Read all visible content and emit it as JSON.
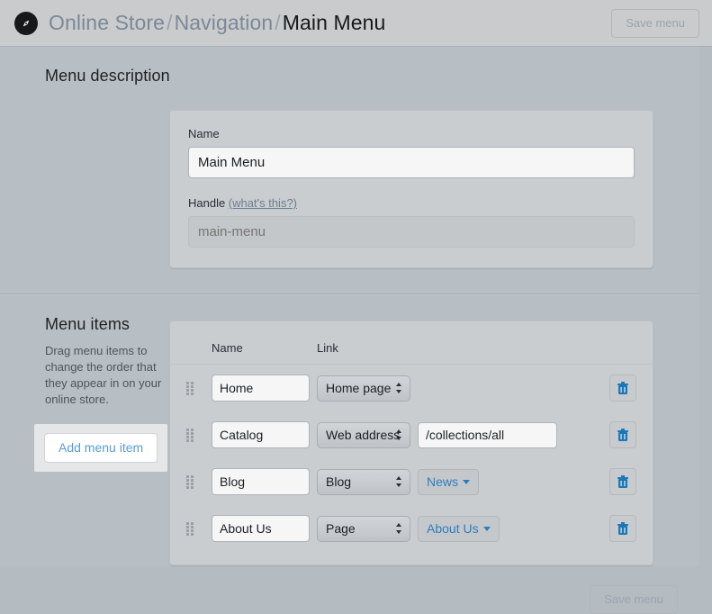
{
  "header": {
    "icon": "compass-icon",
    "breadcrumb": [
      {
        "label": "Online Store",
        "current": false
      },
      {
        "label": "Navigation",
        "current": false
      },
      {
        "label": "Main Menu",
        "current": true
      }
    ],
    "separator": "/",
    "save_label": "Save menu",
    "save_disabled": true
  },
  "description_section": {
    "heading": "Menu description",
    "name_label": "Name",
    "name_value": "Main Menu",
    "handle_label": "Handle",
    "handle_help_link": "(what's this?)",
    "handle_placeholder": "main-menu",
    "handle_value": ""
  },
  "items_section": {
    "heading": "Menu items",
    "help_text": "Drag menu items to change the order that they appear in on your online store.",
    "add_label": "Add menu item",
    "columns": {
      "handle": "",
      "name": "Name",
      "link": "Link"
    },
    "rows": [
      {
        "drag": "drag-handle",
        "name": "Home",
        "link_type": "Home page",
        "url": null,
        "sub": null,
        "delete": "delete-icon"
      },
      {
        "drag": "drag-handle",
        "name": "Catalog",
        "link_type": "Web address",
        "url": "/collections/all",
        "sub": null,
        "delete": "delete-icon"
      },
      {
        "drag": "drag-handle",
        "name": "Blog",
        "link_type": "Blog",
        "url": null,
        "sub": "News",
        "delete": "delete-icon"
      },
      {
        "drag": "drag-handle",
        "name": "About Us",
        "link_type": "Page",
        "url": null,
        "sub": "About Us",
        "delete": "delete-icon"
      }
    ]
  },
  "footer": {
    "save_label": "Save menu",
    "save_disabled": true
  },
  "colors": {
    "page_background": "#b8bfc4",
    "header_background": "#c9cbcd",
    "card_background": "#cacdd0",
    "link_blue": "#2f7cbf",
    "add_button_blue": "#5a9bd8",
    "disabled_text": "#9ba4ad",
    "breadcrumb_gray": "#7c8897",
    "current_crumb": "#17181a"
  }
}
